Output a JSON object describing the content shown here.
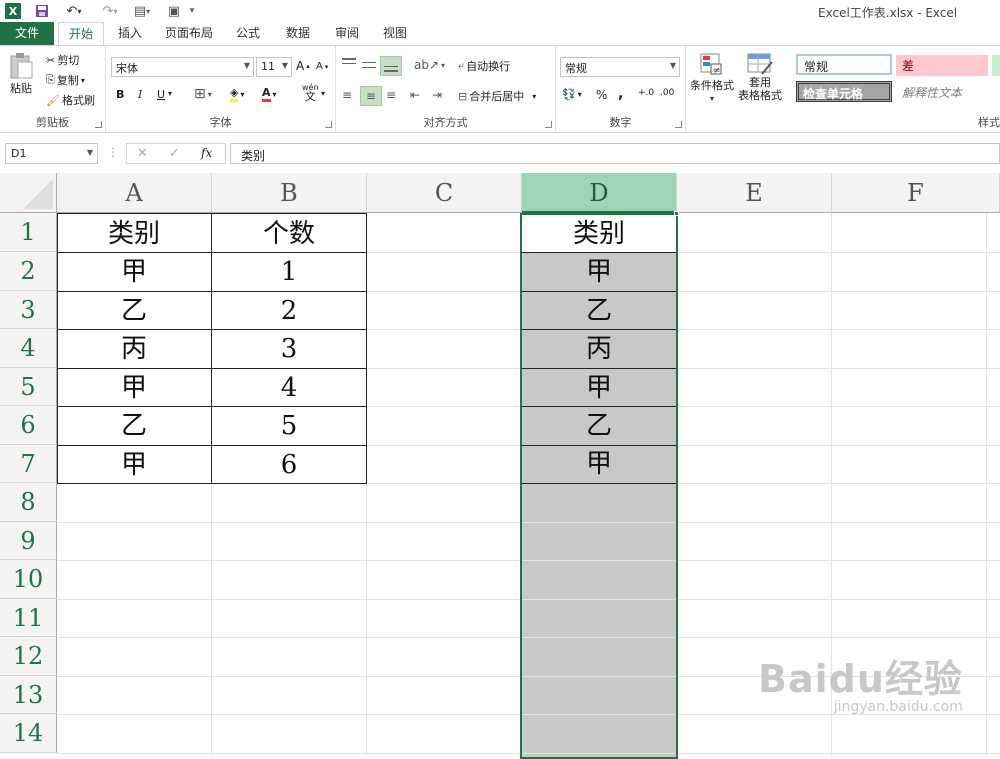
{
  "title_bar": {
    "window_title": "Excel工作表.xlsx - Excel"
  },
  "tabs": [
    "文件",
    "开始",
    "插入",
    "页面布局",
    "公式",
    "数据",
    "审阅",
    "视图"
  ],
  "ribbon": {
    "clipboard": {
      "paste": "粘贴",
      "cut": "剪切",
      "copy": "复制",
      "format_painter": "格式刷",
      "label": "剪贴板"
    },
    "font": {
      "name": "宋体",
      "size": "11",
      "bold": "B",
      "italic": "I",
      "underline": "U",
      "label": "字体",
      "wen": "wén",
      "wen_char": "文"
    },
    "alignment": {
      "wrap_text": "自动换行",
      "merge_center": "合并后居中",
      "label": "对齐方式"
    },
    "number": {
      "format": "常规",
      "percent": "%",
      "comma": ",",
      "label": "数字"
    },
    "styles": {
      "conditional_format": "条件格式",
      "table_format_line1": "套用",
      "table_format_line2": "表格格式",
      "normal": "常规",
      "bad": "差",
      "check_cell": "检查单元格",
      "explanatory": "解释性文本",
      "label": "样式"
    }
  },
  "formula_bar": {
    "name_box": "D1",
    "fx": "fx",
    "content": "类别"
  },
  "grid": {
    "columns": [
      "A",
      "B",
      "C",
      "D",
      "E",
      "F"
    ],
    "rows": [
      "1",
      "2",
      "3",
      "4",
      "5",
      "6",
      "7",
      "8",
      "9",
      "10",
      "11",
      "12",
      "13",
      "14"
    ],
    "col_a": [
      "类别",
      "甲",
      "乙",
      "丙",
      "甲",
      "乙",
      "甲"
    ],
    "col_b": [
      "个数",
      "1",
      "2",
      "3",
      "4",
      "5",
      "6"
    ],
    "col_d": [
      "类别",
      "甲",
      "乙",
      "丙",
      "甲",
      "乙",
      "甲"
    ],
    "selected_column": "D",
    "active_cell": "D1"
  },
  "watermark": {
    "brand": "Baidu经验",
    "url": "jingyan.baidu.com"
  },
  "colors": {
    "excel_green": "#217346",
    "selected_header": "#9fd5b7",
    "shade": "#c8c8c8"
  }
}
